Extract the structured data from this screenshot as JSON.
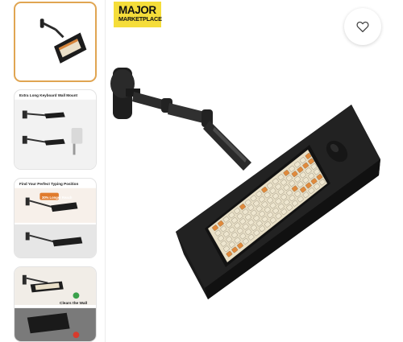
{
  "brand": {
    "line1": "MAJOR",
    "line2": "MARKETPLACE"
  },
  "favorite": {
    "icon": "heart-outline-icon"
  },
  "thumbnails": [
    {
      "selected": true
    },
    {
      "heading": "Extra Long Keyboard Wall Mount"
    },
    {
      "heading": "Find Your Perfect Typing Position",
      "badge": "30% Longer",
      "badge2": "Reach"
    },
    {
      "caption": "Clears the Wall"
    }
  ],
  "colors": {
    "selected_border": "#e0a552",
    "brand_yellow": "#f5dd3a",
    "key_orange": "#e08a3c",
    "key_cream": "#eee6cf"
  }
}
